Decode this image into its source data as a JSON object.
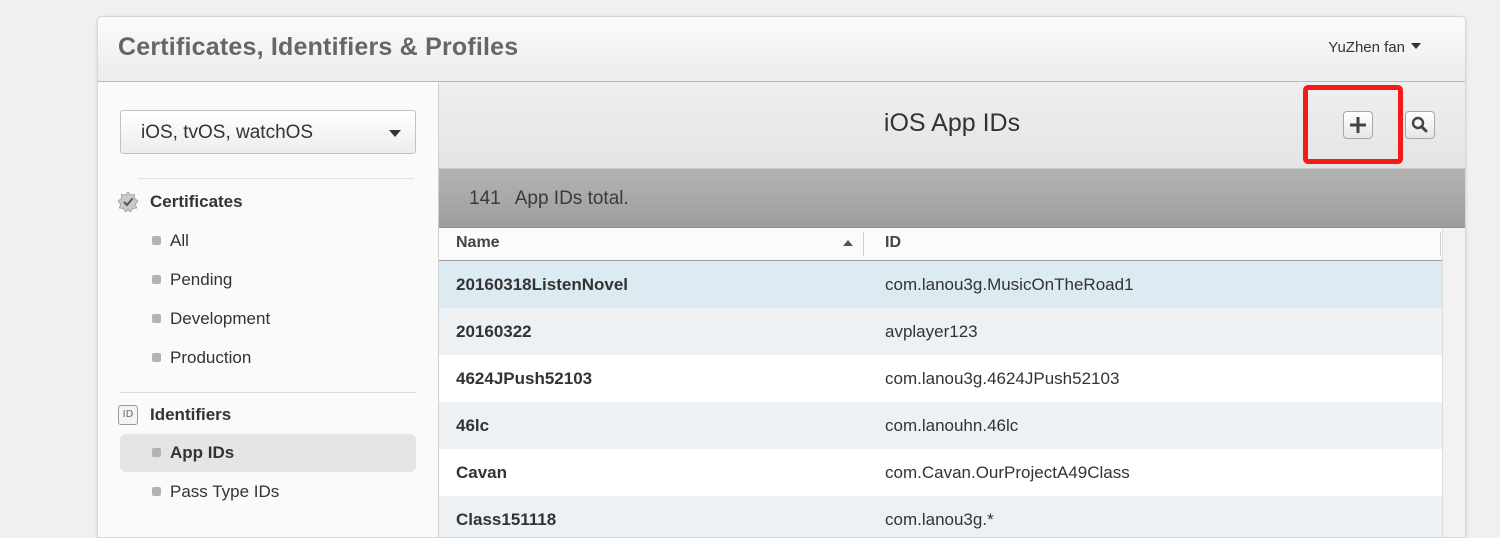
{
  "header": {
    "title": "Certificates, Identifiers & Profiles",
    "user": "YuZhen fan"
  },
  "sidebar": {
    "platform": "iOS, tvOS, watchOS",
    "sections": [
      {
        "title": "Certificates",
        "icon": "certificate-badge-icon",
        "items": [
          "All",
          "Pending",
          "Development",
          "Production"
        ]
      },
      {
        "title": "Identifiers",
        "icon": "id-icon",
        "icon_text": "ID",
        "items": [
          "App IDs",
          "Pass Type IDs"
        ],
        "selected": "App IDs"
      }
    ]
  },
  "main": {
    "title": "iOS App IDs",
    "toolbar": {
      "add_icon": "plus-icon",
      "search_icon": "search-icon",
      "highlight_color": "#f41a1a"
    },
    "count": "141",
    "count_label": "App IDs total.",
    "columns": [
      "Name",
      "ID"
    ],
    "rows": [
      {
        "name": "20160318ListenNovel",
        "id": "com.lanou3g.MusicOnTheRoad1",
        "bg": "#dceaf1"
      },
      {
        "name": "20160322",
        "id": "avplayer123",
        "bg": "#edf1f4"
      },
      {
        "name": "4624JPush52103",
        "id": "com.lanou3g.4624JPush52103",
        "bg": "#ffffff"
      },
      {
        "name": "46lc",
        "id": "com.lanouhn.46lc",
        "bg": "#edf1f4"
      },
      {
        "name": "Cavan",
        "id": "com.Cavan.OurProjectA49Class",
        "bg": "#ffffff"
      },
      {
        "name": "Class151118",
        "id": "com.lanou3g.*",
        "bg": "#edf1f4"
      }
    ]
  }
}
